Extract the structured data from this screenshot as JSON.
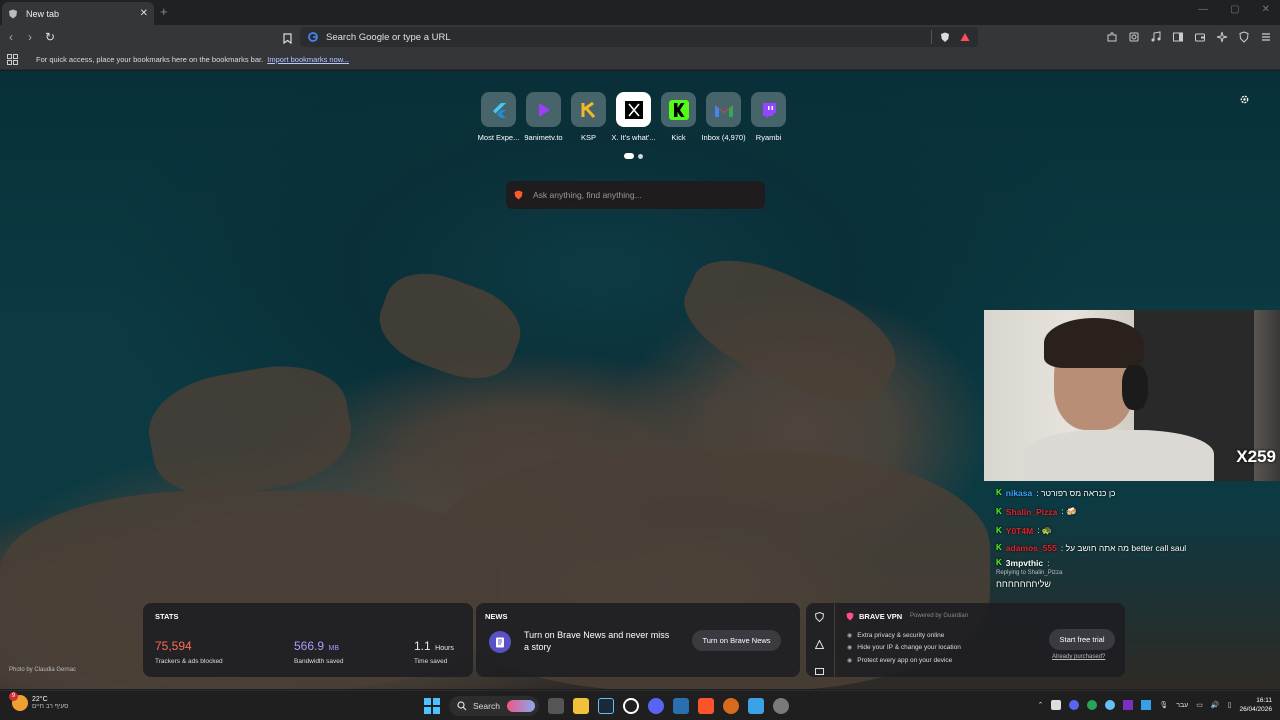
{
  "tab": {
    "title": "New tab",
    "close": "✕",
    "new": "+"
  },
  "window": {
    "minimize": "—",
    "maximize": "▢",
    "close": "✕"
  },
  "toolbar": {
    "back": "‹",
    "forward": "›",
    "reload": "↻"
  },
  "omnibox": {
    "placeholder": "Search Google or type a URL"
  },
  "bookmarks_bar": {
    "text": "For quick access, place your bookmarks here on the bookmarks bar.",
    "link": "Import bookmarks now..."
  },
  "top_sites": [
    {
      "name": "Most Expe...",
      "icon": "flutter-icon",
      "color": "#46c8f5"
    },
    {
      "name": "9animetv.to",
      "icon": "play-icon",
      "color": "#9b3ff2"
    },
    {
      "name": "KSP",
      "icon": "ksp-icon",
      "color": "#f2b82a"
    },
    {
      "name": "X. It's what'...",
      "icon": "x-icon",
      "color": "#000000"
    },
    {
      "name": "Kick",
      "icon": "kick-icon",
      "color": "#53fc18"
    },
    {
      "name": "Inbox (4,970)",
      "icon": "gmail-icon",
      "color": "#ea4335"
    },
    {
      "name": "Ryambi",
      "icon": "twitch-icon",
      "color": "#9146ff"
    }
  ],
  "ntp_search": {
    "placeholder": "Ask anything, find anything..."
  },
  "webcam": {
    "badge": "X259"
  },
  "chat": {
    "lines": [
      {
        "user": "nikasa",
        "user_color": "#3aa0ff",
        "text": ": כן כנראה מס רפורטר"
      },
      {
        "user": "Shalin_Pizza",
        "user_color": "#e0202a",
        "text": ": 🍻"
      },
      {
        "user": "Y0T4M",
        "user_color": "#e0202a",
        "text": ": 🐢"
      },
      {
        "user": "adamos_555",
        "user_color": "#e0202a",
        "text": ": מה אתה חושב על better call saul"
      },
      {
        "user": "3mpvthic",
        "user_color": "#ffffff",
        "text": ":"
      }
    ],
    "reply_to": "Replying to Shalin_Pizza",
    "last_message": "שליחחחחחחח"
  },
  "stats": {
    "header": "STATS",
    "items": [
      {
        "value": "75,594",
        "unit": "",
        "label": "Trackers & ads blocked",
        "color": "#ff6b5a"
      },
      {
        "value": "566.9",
        "unit": "MB",
        "label": "Bandwidth saved",
        "color": "#a99cff"
      },
      {
        "value": "1.1",
        "unit": "Hours",
        "label": "Time saved",
        "color": "#ffffff"
      }
    ]
  },
  "news": {
    "header": "NEWS",
    "message": "Turn on Brave News and never miss a story",
    "button": "Turn on Brave News"
  },
  "vpn": {
    "title": "BRAVE VPN",
    "powered": "Powered by Guardian",
    "features": [
      "Extra privacy & security online",
      "Hide your IP & change your location",
      "Protect every app on your device"
    ],
    "cta": "Start free trial",
    "already": "Already purchased?"
  },
  "photo_credit": "Photo by Claudia Gernac",
  "taskbar": {
    "temperature": "22°C",
    "weather_desc": "סעיף רב חיים",
    "weather_badge": "9",
    "search_label": "Search",
    "lang": "עבר",
    "time": "16:11",
    "date": "26/04/2026"
  }
}
